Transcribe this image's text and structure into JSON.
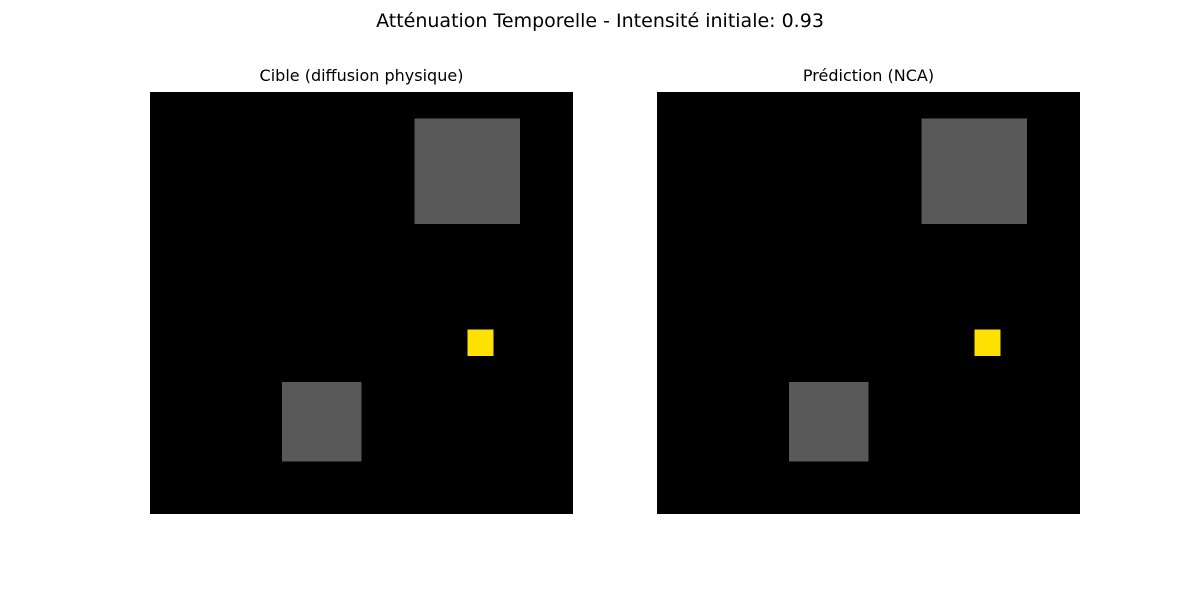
{
  "figure": {
    "suptitle": "Atténuation Temporelle - Intensité initiale: 0.93"
  },
  "chart_data": [
    {
      "type": "heatmap",
      "title": "Cible (diffusion physique)",
      "grid_size": [
        32,
        32
      ],
      "background_color": "#000000",
      "axes": "off",
      "cells": [
        {
          "kind": "obstacle",
          "col": 20,
          "row": 2,
          "width": 8,
          "height": 8,
          "color": "#595959"
        },
        {
          "kind": "obstacle",
          "col": 10,
          "row": 22,
          "width": 6,
          "height": 6,
          "color": "#595959"
        },
        {
          "kind": "source",
          "col": 24,
          "row": 18,
          "width": 2,
          "height": 2,
          "color": "#ffe100"
        }
      ]
    },
    {
      "type": "heatmap",
      "title": "Prédiction (NCA)",
      "grid_size": [
        32,
        32
      ],
      "background_color": "#000000",
      "axes": "off",
      "cells": [
        {
          "kind": "obstacle",
          "col": 20,
          "row": 2,
          "width": 8,
          "height": 8,
          "color": "#595959"
        },
        {
          "kind": "obstacle",
          "col": 10,
          "row": 22,
          "width": 6,
          "height": 6,
          "color": "#595959"
        },
        {
          "kind": "source",
          "col": 24,
          "row": 18,
          "width": 2,
          "height": 2,
          "color": "#ffe100"
        }
      ]
    }
  ]
}
